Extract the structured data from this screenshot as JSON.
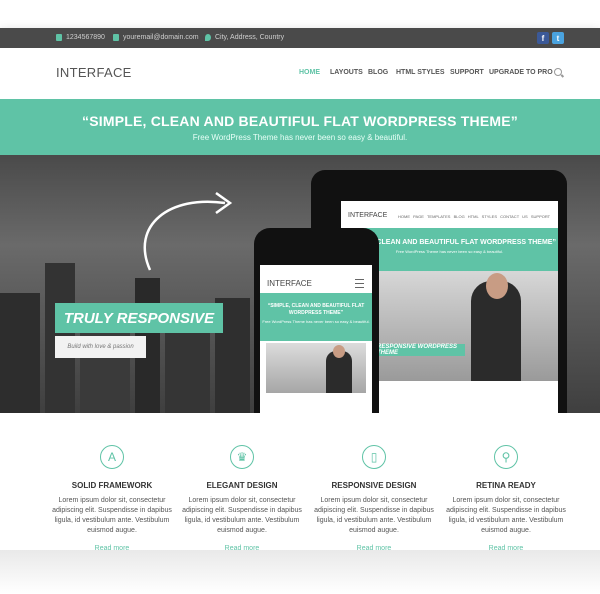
{
  "topbar": {
    "phone": "1234567890",
    "email": "youremail@domain.com",
    "address": "City, Address, Country",
    "social": [
      {
        "icon": "facebook-icon",
        "glyph": "f",
        "color": "#3b5998"
      },
      {
        "icon": "twitter-icon",
        "glyph": "t",
        "color": "#4aa3df"
      }
    ]
  },
  "header": {
    "logo": "INTERFACE",
    "nav": [
      "HOME",
      "LAYOUTS",
      "BLOG",
      "HTML STYLES",
      "SUPPORT",
      "UPGRADE TO PRO"
    ],
    "active_nav": "HOME",
    "search_icon": "search-icon"
  },
  "band": {
    "title": "“SIMPLE, CLEAN AND BEAUTIFUL FLAT WORDPRESS THEME”",
    "subtitle": "Free WordPress Theme has never been so easy & beautiful."
  },
  "hero": {
    "badge": "TRULY RESPONSIVE",
    "tagline": "Build with love & passion"
  },
  "tablet": {
    "logo": "INTERFACE",
    "nav": "HOME   PAGE TEMPLATES   BLOG   HTML STYLES   CONTACT US   SUPPORT",
    "title": "“SIMPLE, CLEAN AND BEAUTIFUL FLAT WORDPRESS THEME”",
    "subtitle": "Free WordPress Theme has never been so easy & beautiful.",
    "badge": "RESPONSIVE WORDPRESS THEME"
  },
  "phone": {
    "logo": "INTERFACE",
    "title": "“SIMPLE, CLEAN AND BEAUTIFUL FLAT WORDPRESS THEME”",
    "subtitle": "Free WordPress Theme has never been so easy & beautiful."
  },
  "features": [
    {
      "icon": "app-store-icon",
      "glyph": "A",
      "title": "SOLID FRAMEWORK",
      "desc": "Lorem ipsum dolor sit, consectetur adipiscing elit. Suspendisse in dapibus ligula, id vestibulum ante. Vestibulum euismod augue.",
      "more": "Read more"
    },
    {
      "icon": "trophy-icon",
      "glyph": "♛",
      "title": "ELEGANT DESIGN",
      "desc": "Lorem ipsum dolor sit, consectetur adipiscing elit. Suspendisse in dapibus ligula, id vestibulum ante. Vestibulum euismod augue.",
      "more": "Read more"
    },
    {
      "icon": "mobile-icon",
      "glyph": "▯",
      "title": "RESPONSIVE DESIGN",
      "desc": "Lorem ipsum dolor sit, consectetur adipiscing elit. Suspendisse in dapibus ligula, id vestibulum ante. Vestibulum euismod augue.",
      "more": "Read more"
    },
    {
      "icon": "magnifier-icon",
      "glyph": "⚲",
      "title": "RETINA READY",
      "desc": "Lorem ipsum dolor sit, consectetur adipiscing elit. Suspendisse in dapibus ligula, id vestibulum ante. Vestibulum euismod augue.",
      "more": "Read more"
    }
  ],
  "colors": {
    "accent": "#5fc3a6",
    "topbar": "#4a4a4a",
    "text": "#333333"
  }
}
